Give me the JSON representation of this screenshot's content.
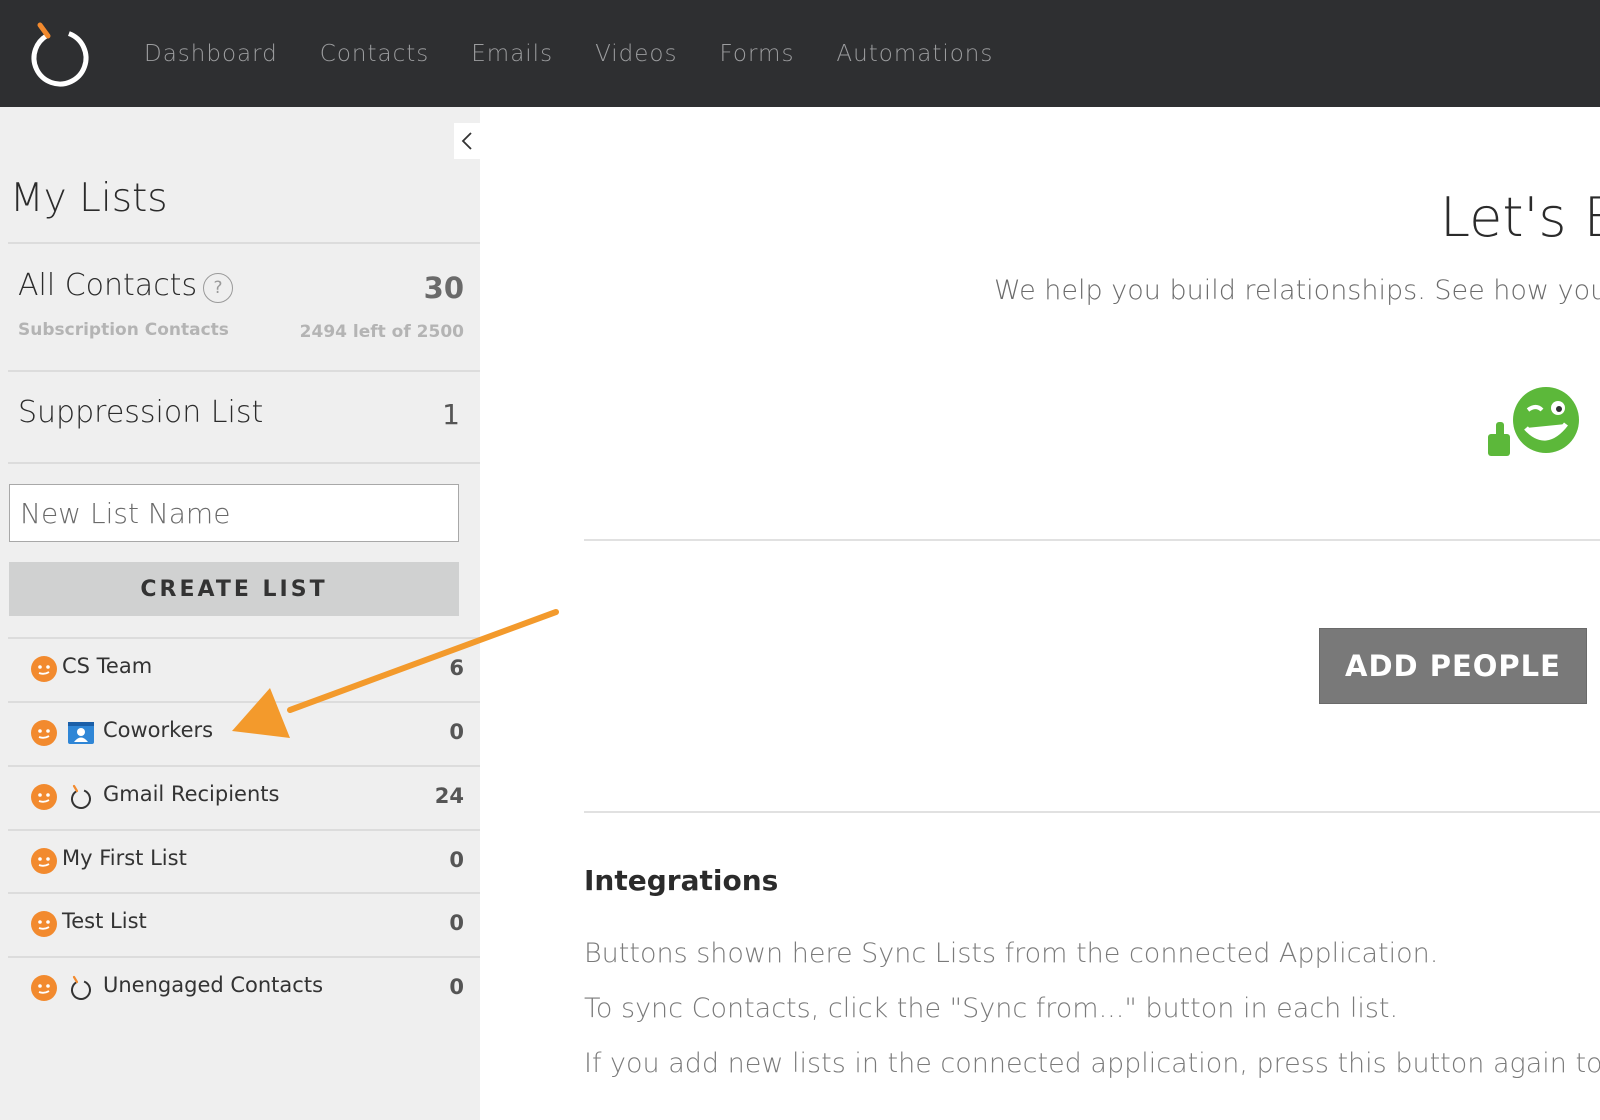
{
  "nav": {
    "items": [
      "Dashboard",
      "Contacts",
      "Emails",
      "Videos",
      "Forms",
      "Automations"
    ]
  },
  "sidebar": {
    "title": "My Lists",
    "all_contacts": {
      "label": "All Contacts",
      "help": "?",
      "count": "30",
      "sub_label": "Subscription Contacts",
      "sub_left": "2494 left of 2500"
    },
    "suppression": {
      "label": "Suppression List",
      "count": "1"
    },
    "new_list": {
      "placeholder": "New List Name"
    },
    "create_button": "CREATE LIST",
    "lists": [
      {
        "name": "CS Team",
        "count": "6",
        "source": ""
      },
      {
        "name": "Coworkers",
        "count": "0",
        "source": "contact-card-icon"
      },
      {
        "name": "Gmail Recipients",
        "count": "24",
        "source": "app-logo-icon"
      },
      {
        "name": "My First List",
        "count": "0",
        "source": ""
      },
      {
        "name": "Test List",
        "count": "0",
        "source": ""
      },
      {
        "name": "Unengaged Contacts",
        "count": "0",
        "source": "app-logo-icon"
      }
    ]
  },
  "main": {
    "title": "Let's B",
    "subtitle": "We help you build relationships. See how you'r",
    "add_people": "ADD PEOPLE",
    "integrations_title": "Integrations",
    "integrations_lines": [
      "Buttons shown here Sync Lists from the connected Application.",
      "To sync Contacts, click the \"Sync from...\" button in each list.",
      "If you add new lists in the connected application, press this button again to ma"
    ]
  },
  "colors": {
    "topbar": "#2e2f31",
    "accent_orange": "#f28a2e",
    "mascot_green": "#5cb83a",
    "button_gray": "#797979"
  }
}
